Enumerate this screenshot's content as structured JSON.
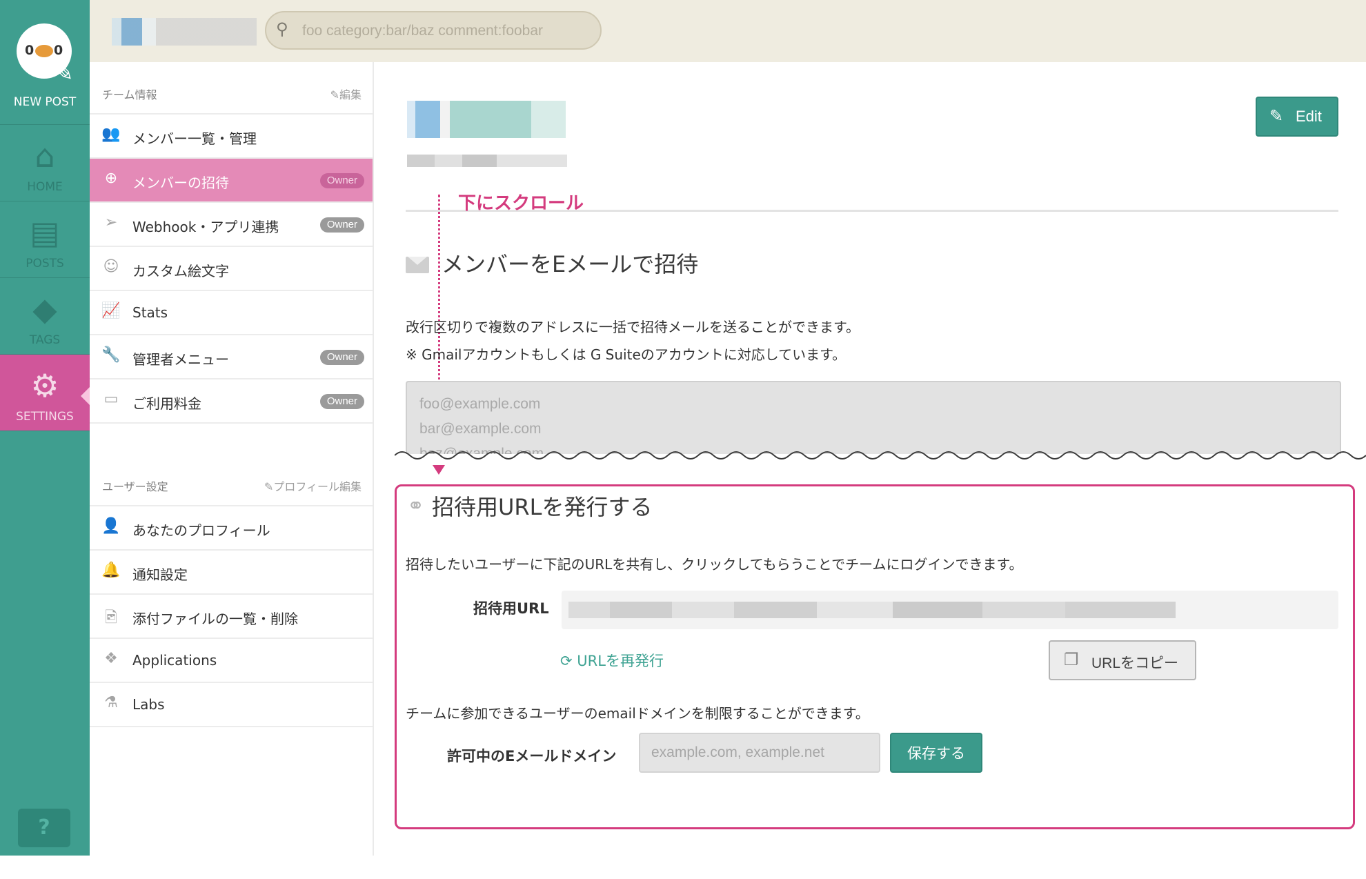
{
  "leftnav": {
    "newpost_label": "NEW POST",
    "items": [
      {
        "label": "HOME",
        "icon": "home-icon",
        "glyph": "⌂"
      },
      {
        "label": "POSTS",
        "icon": "document-icon",
        "glyph": "▤"
      },
      {
        "label": "TAGS",
        "icon": "tag-icon",
        "glyph": "◆"
      },
      {
        "label": "SETTINGS",
        "icon": "gear-icon",
        "glyph": "⚙"
      }
    ],
    "help": "?"
  },
  "topbar": {
    "search_placeholder": "foo category:bar/baz comment:foobar"
  },
  "sidebar": {
    "team_section": {
      "title": "チーム情報",
      "edit": "✎編集"
    },
    "team_items": [
      {
        "label": "メンバー一覧・管理",
        "icon": "members-icon",
        "glyph": "👥",
        "badge": ""
      },
      {
        "label": "メンバーの招待",
        "icon": "plus-circle-icon",
        "glyph": "⊕",
        "badge": "Owner"
      },
      {
        "label": "Webhook・アプリ連携",
        "icon": "paper-plane-icon",
        "glyph": "➢",
        "badge": "Owner"
      },
      {
        "label": "カスタム絵文字",
        "icon": "smile-icon",
        "glyph": "☺",
        "badge": ""
      },
      {
        "label": "Stats",
        "icon": "chart-icon",
        "glyph": "📈",
        "badge": ""
      },
      {
        "label": "管理者メニュー",
        "icon": "wrench-icon",
        "glyph": "🔧",
        "badge": "Owner"
      },
      {
        "label": "ご利用料金",
        "icon": "credit-card-icon",
        "glyph": "▭",
        "badge": "Owner"
      }
    ],
    "user_section": {
      "title": "ユーザー設定",
      "edit": "✎プロフィール編集"
    },
    "user_items": [
      {
        "label": "あなたのプロフィール",
        "icon": "user-icon",
        "glyph": "👤"
      },
      {
        "label": "通知設定",
        "icon": "bell-icon",
        "glyph": "🔔"
      },
      {
        "label": "添付ファイルの一覧・削除",
        "icon": "image-file-icon",
        "glyph": "🖻"
      },
      {
        "label": "Applications",
        "icon": "cubes-icon",
        "glyph": "❖"
      },
      {
        "label": "Labs",
        "icon": "flask-icon",
        "glyph": "⚗"
      }
    ]
  },
  "main": {
    "edit_button": "Edit",
    "scroll_note": "下にスクロール",
    "email_section": {
      "title": "メンバーをEメールで招待",
      "desc1": "改行区切りで複数のアドレスに一括で招待メールを送ることができます。",
      "desc2": "※ Gmailアカウントもしくは G Suiteのアカウントに対応しています。",
      "textarea_placeholder": "foo@example.com\nbar@example.com\nbaz@example.com"
    },
    "url_section": {
      "title": "招待用URLを発行する",
      "desc": "招待したいユーザーに下記のURLを共有し、クリックしてもらうことでチームにログインできます。",
      "url_label": "招待用URL",
      "reissue": "URLを再発行",
      "copy_button": "URLをコピー",
      "domain_desc": "チームに参加できるユーザーのemailドメインを制限することができます。",
      "domain_label": "許可中のEメールドメイン",
      "domain_placeholder": "example.com, example.net",
      "save_button": "保存する"
    }
  }
}
